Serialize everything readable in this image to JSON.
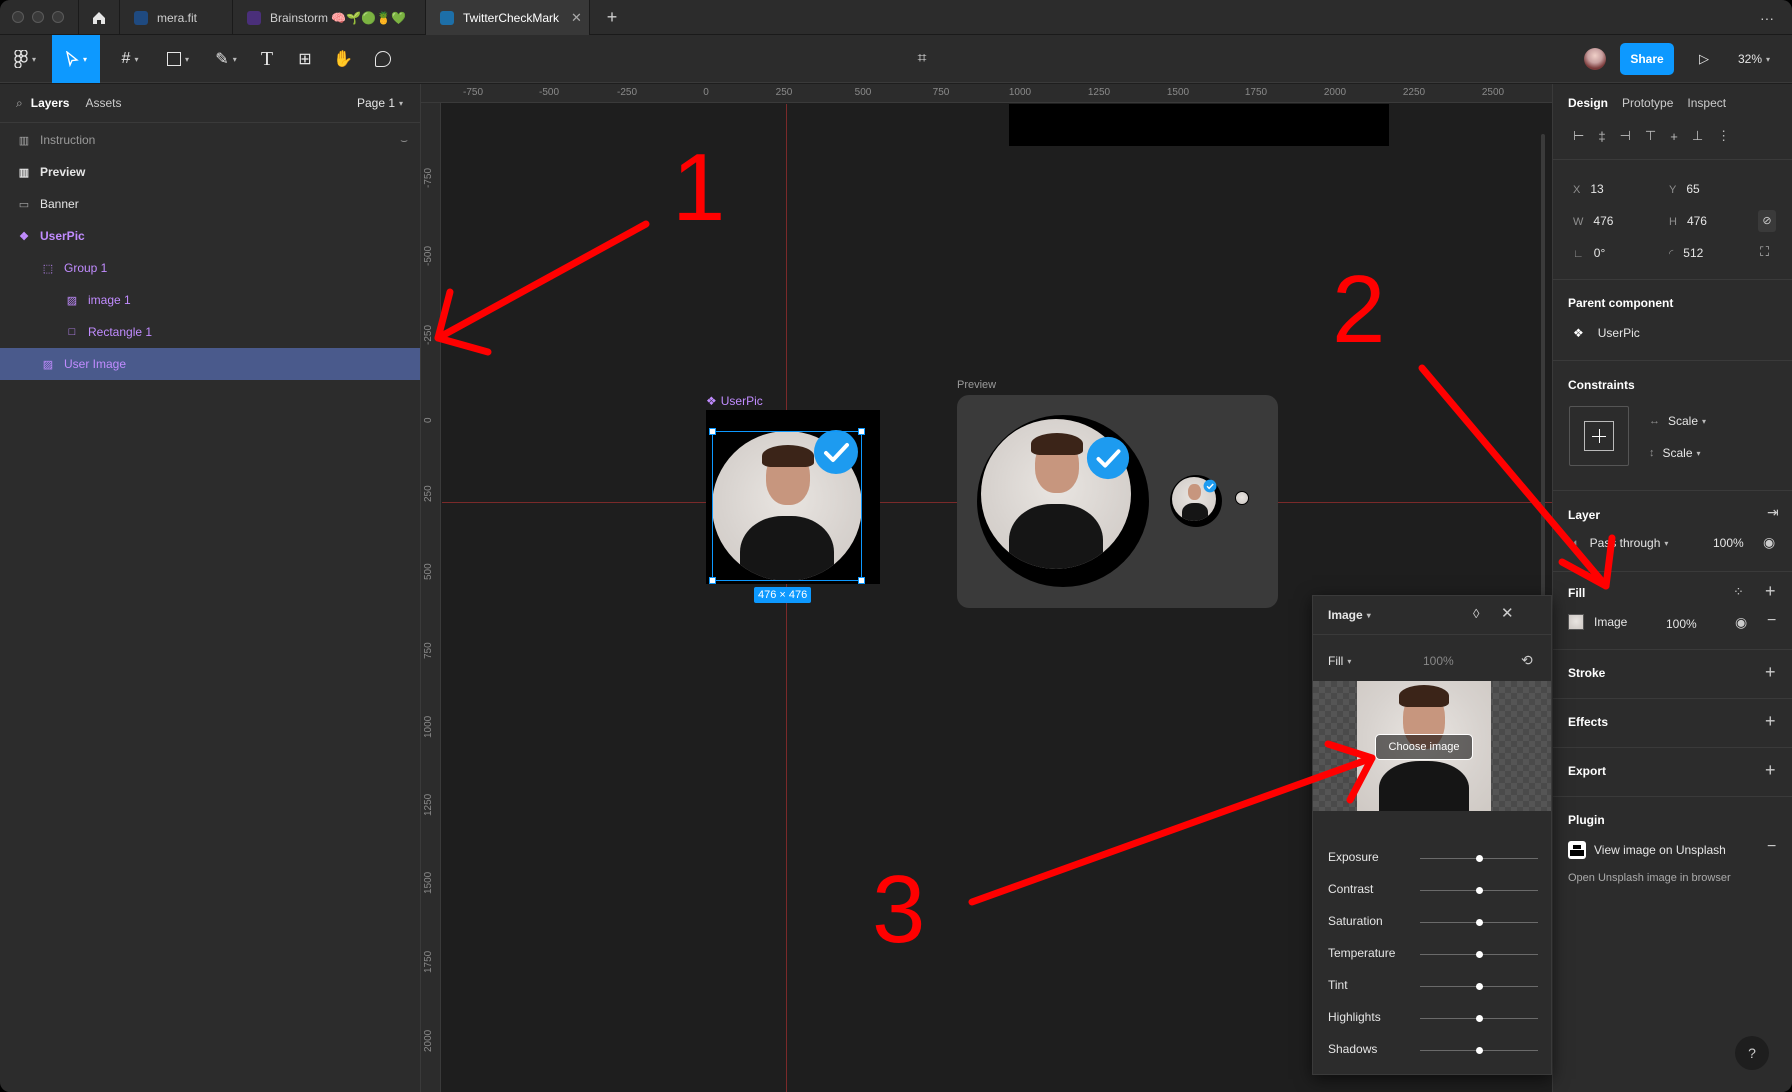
{
  "tabs": [
    {
      "label": "mera.fit",
      "color": "#2d7ff9"
    },
    {
      "label": "Brainstorm 🧠🌱🟢🍍💚",
      "color": "#8a56d8"
    },
    {
      "label": "TwitterCheckMark",
      "color": "#1da1f2"
    }
  ],
  "tabbar": {
    "add": "+",
    "more": "···"
  },
  "toolbar": {
    "share": "Share",
    "zoom": "32%"
  },
  "left": {
    "tabs": [
      "Layers",
      "Assets"
    ],
    "page": "Page 1",
    "layers": [
      {
        "name": "Instruction",
        "icon": "frame-icon"
      },
      {
        "name": "Preview",
        "icon": "frame-icon"
      },
      {
        "name": "Banner",
        "icon": "rectangle-icon"
      },
      {
        "name": "UserPic",
        "icon": "component-icon"
      },
      {
        "name": "Group 1",
        "icon": "group-icon"
      },
      {
        "name": "image 1",
        "icon": "image-icon"
      },
      {
        "name": "Rectangle 1",
        "icon": "rectangle-icon"
      },
      {
        "name": "User Image",
        "icon": "image-icon"
      }
    ]
  },
  "ruler": {
    "top": [
      "-750",
      "-500",
      "-250",
      "0",
      "250",
      "500",
      "750",
      "1000",
      "1250",
      "1500",
      "1750",
      "2000",
      "2250",
      "2500"
    ],
    "left": [
      "-750",
      "-500",
      "-250",
      "0",
      "250",
      "500",
      "750",
      "1000",
      "1250",
      "1500",
      "1750",
      "2000"
    ]
  },
  "canvas": {
    "userpic_label": "UserPic",
    "preview_label": "Preview",
    "size_badge": "476 × 476"
  },
  "right": {
    "tabs": [
      "Design",
      "Prototype",
      "Inspect"
    ],
    "x_label": "X",
    "x": "13",
    "y_label": "Y",
    "y": "65",
    "w_label": "W",
    "w": "476",
    "h_label": "H",
    "h": "476",
    "rotation": "0°",
    "radius": "512",
    "parent_component_title": "Parent component",
    "parent_component": "UserPic",
    "constraints_title": "Constraints",
    "constraint_h": "Scale",
    "constraint_v": "Scale",
    "layer_title": "Layer",
    "blend": "Pass through",
    "layer_opacity": "100%",
    "fill_title": "Fill",
    "fill_name": "Image",
    "fill_opacity": "100%",
    "stroke_title": "Stroke",
    "effects_title": "Effects",
    "export_title": "Export",
    "plugin_title": "Plugin",
    "plugin_name": "View image on Unsplash",
    "plugin_desc": "Open Unsplash image in browser",
    "help": "?"
  },
  "popup": {
    "title": "Image",
    "mode": "Fill",
    "opacity": "100%",
    "choose": "Choose image",
    "sliders": [
      {
        "label": "Exposure",
        "value": 0.5
      },
      {
        "label": "Contrast",
        "value": 0.5
      },
      {
        "label": "Saturation",
        "value": 0.5
      },
      {
        "label": "Temperature",
        "value": 0.5
      },
      {
        "label": "Tint",
        "value": 0.5
      },
      {
        "label": "Highlights",
        "value": 0.5
      },
      {
        "label": "Shadows",
        "value": 0.5
      }
    ]
  },
  "annotations": [
    "1",
    "2",
    "3"
  ],
  "colors": {
    "accent": "#0d99ff",
    "annotation": "#ff0000",
    "component": "#c18cff",
    "selection": "#4a5a8c"
  }
}
